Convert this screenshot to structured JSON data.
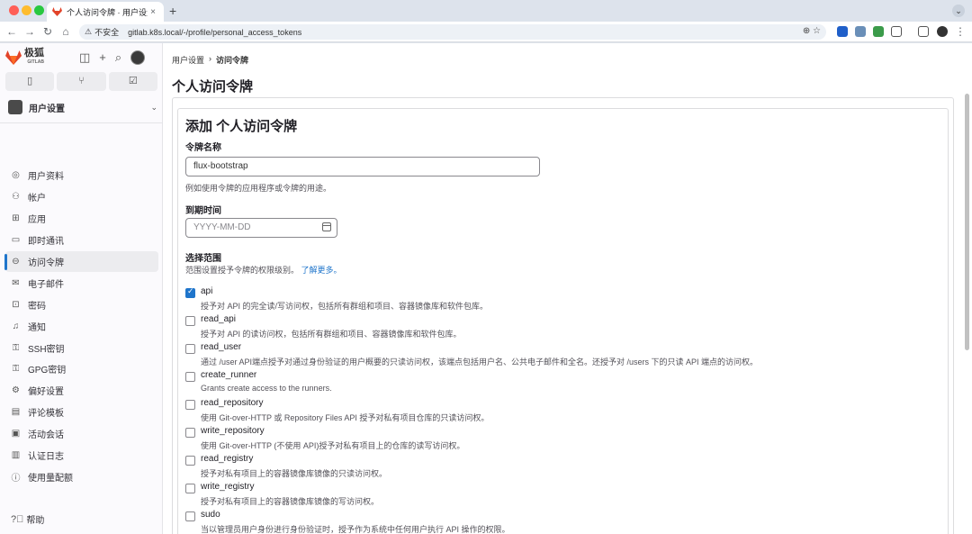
{
  "browser": {
    "tab_title": "个人访问令牌 · 用户设置 · 极狐",
    "tab_close": "×",
    "new_tab": "+",
    "insecure_label": "不安全",
    "url": "gitlab.k8s.local/-/profile/personal_access_tokens"
  },
  "sidebar": {
    "logo_text": "极狐",
    "logo_sub": "GITLAB",
    "context_label": "用户设置",
    "items": [
      {
        "label": "用户资料",
        "icon": "profile-icon",
        "glyph": "◎"
      },
      {
        "label": "帐户",
        "icon": "account-icon",
        "glyph": "⚇"
      },
      {
        "label": "应用",
        "icon": "applications-icon",
        "glyph": "⊞"
      },
      {
        "label": "即时通讯",
        "icon": "chat-icon",
        "glyph": "▭"
      },
      {
        "label": "访问令牌",
        "icon": "token-icon",
        "glyph": "⊖",
        "active": true
      },
      {
        "label": "电子邮件",
        "icon": "mail-icon",
        "glyph": "✉"
      },
      {
        "label": "密码",
        "icon": "lock-icon",
        "glyph": "⊡"
      },
      {
        "label": "通知",
        "icon": "bell-icon",
        "glyph": "♫"
      },
      {
        "label": "SSH密钥",
        "icon": "ssh-key-icon",
        "glyph": "⚿"
      },
      {
        "label": "GPG密钥",
        "icon": "gpg-key-icon",
        "glyph": "⚿"
      },
      {
        "label": "偏好设置",
        "icon": "preferences-icon",
        "glyph": "⚙"
      },
      {
        "label": "评论模板",
        "icon": "comment-template-icon",
        "glyph": "▤"
      },
      {
        "label": "活动会话",
        "icon": "sessions-icon",
        "glyph": "▣"
      },
      {
        "label": "认证日志",
        "icon": "log-icon",
        "glyph": "▥"
      },
      {
        "label": "使用量配额",
        "icon": "quota-icon",
        "glyph": "ⓘ"
      }
    ],
    "help_label": "帮助"
  },
  "main": {
    "breadcrumb_parent": "用户设置",
    "breadcrumb_current": "访问令牌",
    "page_title": "个人访问令牌",
    "form_title": "添加 个人访问令牌",
    "token_name_label": "令牌名称",
    "token_name_value": "flux-bootstrap",
    "token_name_help": "例如使用令牌的应用程序或令牌的用途。",
    "expiry_label": "到期时间",
    "expiry_placeholder": "YYYY-MM-DD",
    "scopes_label": "选择范围",
    "scopes_help": "范围设置授予令牌的权限级别。",
    "scopes_learn_more": "了解更多。",
    "scopes": [
      {
        "name": "api",
        "checked": true,
        "desc": "授予对 API 的完全读/写访问权，包括所有群组和项目、容器镜像库和软件包库。"
      },
      {
        "name": "read_api",
        "checked": false,
        "desc": "授予对 API 的读访问权，包括所有群组和项目、容器镜像库和软件包库。"
      },
      {
        "name": "read_user",
        "checked": false,
        "desc": "通过 /user API端点授予对通过身份验证的用户概要的只读访问权，该端点包括用户名、公共电子邮件和全名。还授予对 /users 下的只读 API 端点的访问权。"
      },
      {
        "name": "create_runner",
        "checked": false,
        "desc": "Grants create access to the runners."
      },
      {
        "name": "read_repository",
        "checked": false,
        "desc": "使用 Git-over-HTTP 或 Repository Files API 授予对私有项目仓库的只读访问权。"
      },
      {
        "name": "write_repository",
        "checked": false,
        "desc": "使用 Git-over-HTTP (不使用 API)授予对私有项目上的仓库的读写访问权。"
      },
      {
        "name": "read_registry",
        "checked": false,
        "desc": "授予对私有项目上的容器镜像库镜像的只读访问权。"
      },
      {
        "name": "write_registry",
        "checked": false,
        "desc": "授予对私有项目上的容器镜像库镜像的写访问权。"
      },
      {
        "name": "sudo",
        "checked": false,
        "desc": "当以管理员用户身份进行身份验证时，授予作为系统中任何用户执行 API 操作的权限。"
      }
    ]
  }
}
